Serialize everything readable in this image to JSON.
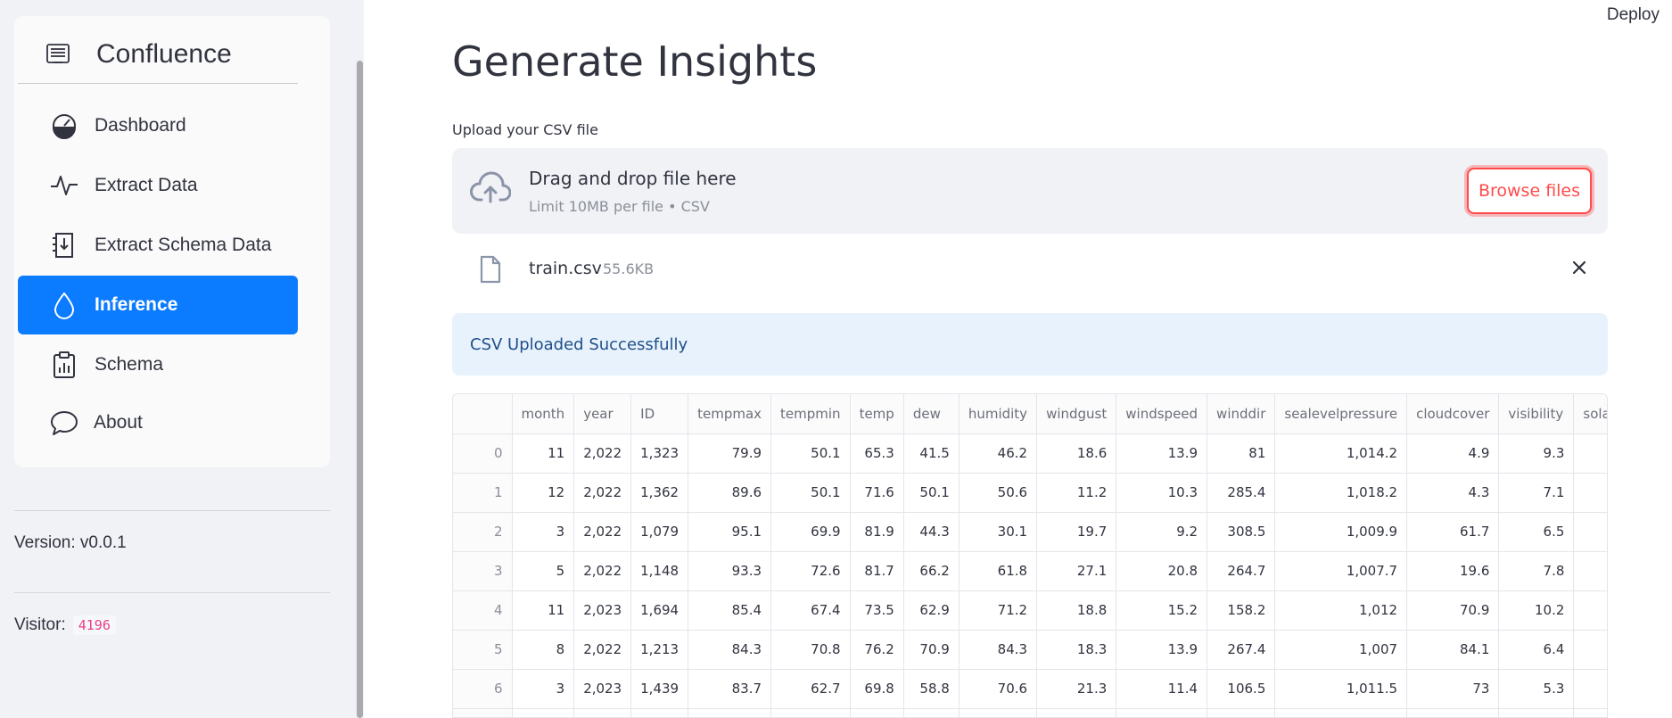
{
  "sidebar": {
    "brand": "Confluence",
    "items": [
      {
        "label": "Dashboard",
        "icon": "speedometer-icon"
      },
      {
        "label": "Extract Data",
        "icon": "activity-icon"
      },
      {
        "label": "Extract Schema Data",
        "icon": "file-download-icon"
      },
      {
        "label": "Inference",
        "icon": "droplet-icon",
        "active": true
      },
      {
        "label": "Schema",
        "icon": "clipboard-chart-icon"
      },
      {
        "label": "About",
        "icon": "chat-bubble-icon"
      }
    ],
    "version_text": "Version: v0.0.1",
    "visitor_label": "Visitor:",
    "visitor_count": "4196"
  },
  "header": {
    "deploy_label": "Deploy"
  },
  "main": {
    "title": "Generate Insights",
    "upload_label": "Upload your CSV file",
    "dropzone": {
      "title": "Drag and drop file here",
      "subtitle": "Limit 10MB per file • CSV",
      "browse_label": "Browse files"
    },
    "file": {
      "name": "train.csv",
      "size": "55.6KB"
    },
    "alert": "CSV Uploaded Successfully",
    "table": {
      "columns": [
        "",
        "month",
        "year",
        "ID",
        "tempmax",
        "tempmin",
        "temp",
        "dew",
        "humidity",
        "windgust",
        "windspeed",
        "winddir",
        "sealevelpressure",
        "cloudcover",
        "visibility",
        "solarra"
      ],
      "rows": [
        [
          "0",
          "11",
          "2,022",
          "1,323",
          "79.9",
          "50.1",
          "65.3",
          "41.5",
          "46.2",
          "18.6",
          "13.9",
          "81",
          "1,014.2",
          "4.9",
          "9.3",
          ""
        ],
        [
          "1",
          "12",
          "2,022",
          "1,362",
          "89.6",
          "50.1",
          "71.6",
          "50.1",
          "50.6",
          "11.2",
          "10.3",
          "285.4",
          "1,018.2",
          "4.3",
          "7.1",
          ""
        ],
        [
          "2",
          "3",
          "2,022",
          "1,079",
          "95.1",
          "69.9",
          "81.9",
          "44.3",
          "30.1",
          "19.7",
          "9.2",
          "308.5",
          "1,009.9",
          "61.7",
          "6.5",
          ""
        ],
        [
          "3",
          "5",
          "2,022",
          "1,148",
          "93.3",
          "72.6",
          "81.7",
          "66.2",
          "61.8",
          "27.1",
          "20.8",
          "264.7",
          "1,007.7",
          "19.6",
          "7.8",
          ""
        ],
        [
          "4",
          "11",
          "2,023",
          "1,694",
          "85.4",
          "67.4",
          "73.5",
          "62.9",
          "71.2",
          "18.8",
          "15.2",
          "158.2",
          "1,012",
          "70.9",
          "10.2",
          ""
        ],
        [
          "5",
          "8",
          "2,022",
          "1,213",
          "84.3",
          "70.8",
          "76.2",
          "70.9",
          "84.3",
          "18.3",
          "13.9",
          "267.4",
          "1,007",
          "84.1",
          "6.4",
          ""
        ],
        [
          "6",
          "3",
          "2,023",
          "1,439",
          "83.7",
          "62.7",
          "69.8",
          "58.8",
          "70.6",
          "21.3",
          "11.4",
          "106.5",
          "1,011.5",
          "73",
          "5.3",
          ""
        ],
        [
          "",
          "",
          "",
          "",
          "",
          "",
          "",
          "",
          "",
          "",
          "",
          "",
          "",
          "",
          "",
          ""
        ]
      ]
    }
  },
  "colors": {
    "accent": "#0b7bff",
    "primary": "#ff4b4b",
    "sidebar_bg": "#f0f2f6",
    "alert_bg": "#e8f2fc",
    "visitor_badge": "#e83e8c"
  }
}
